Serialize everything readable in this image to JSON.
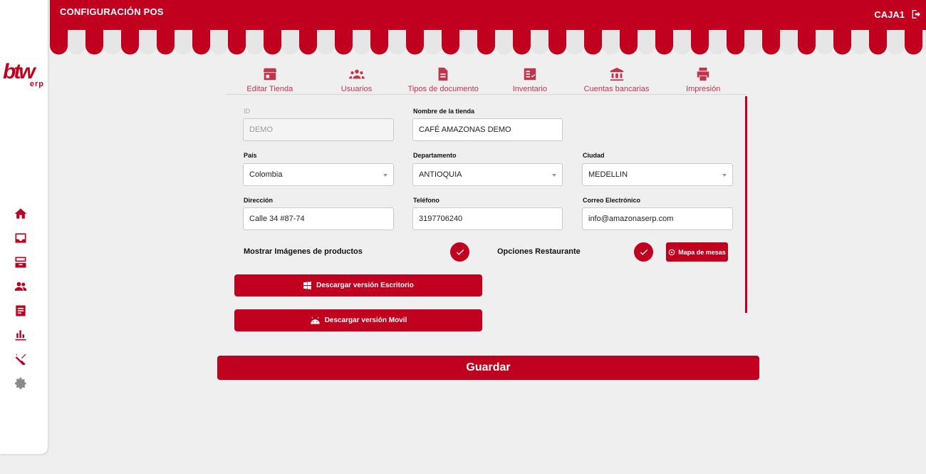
{
  "header": {
    "title": "CONFIGURACIÓN POS",
    "user": "CAJA1"
  },
  "brand": {
    "logo_main": "btw",
    "logo_sub": "erp",
    "accent": "#c0001e"
  },
  "sidebar": {
    "items": [
      {
        "icon": "home-icon"
      },
      {
        "icon": "inbox-icon"
      },
      {
        "icon": "tray-icon"
      },
      {
        "icon": "users-icon"
      },
      {
        "icon": "receipt-icon"
      },
      {
        "icon": "chart-icon"
      },
      {
        "icon": "utensils-icon"
      },
      {
        "icon": "gear-icon"
      }
    ]
  },
  "tabs": [
    {
      "label": "Editar Tienda",
      "icon": "store-icon"
    },
    {
      "label": "Usuarios",
      "icon": "users-icon"
    },
    {
      "label": "Tipos de documento",
      "icon": "document-icon"
    },
    {
      "label": "Inventario",
      "icon": "inventory-icon"
    },
    {
      "label": "Cuentas bancarias",
      "icon": "bank-icon"
    },
    {
      "label": "Impresión",
      "icon": "printer-icon"
    }
  ],
  "form": {
    "id": {
      "label": "ID",
      "value": "DEMO"
    },
    "store_name": {
      "label": "Nombre de la tienda",
      "value": "CAFÉ AMAZONAS DEMO"
    },
    "country": {
      "label": "País",
      "value": "Colombia"
    },
    "department": {
      "label": "Departamento",
      "value": "ANTIOQUIA"
    },
    "city": {
      "label": "Ciudad",
      "value": "MEDELLIN"
    },
    "address": {
      "label": "Dirección",
      "value": "Calle 34 #87-74"
    },
    "phone": {
      "label": "Teléfono",
      "value": "3197706240"
    },
    "email": {
      "label": "Correo Electrónico",
      "value": "info@amazonaserp.com"
    }
  },
  "toggles": {
    "show_images": {
      "label": "Mostrar Imágenes de productos",
      "checked": true
    },
    "restaurant": {
      "label": "Opciones Restaurante",
      "checked": true
    }
  },
  "buttons": {
    "table_map": "Mapa de mesas",
    "download_desktop": "Descargar versión Escritorio",
    "download_mobile": "Descargar versión Movil",
    "save": "Guardar"
  }
}
